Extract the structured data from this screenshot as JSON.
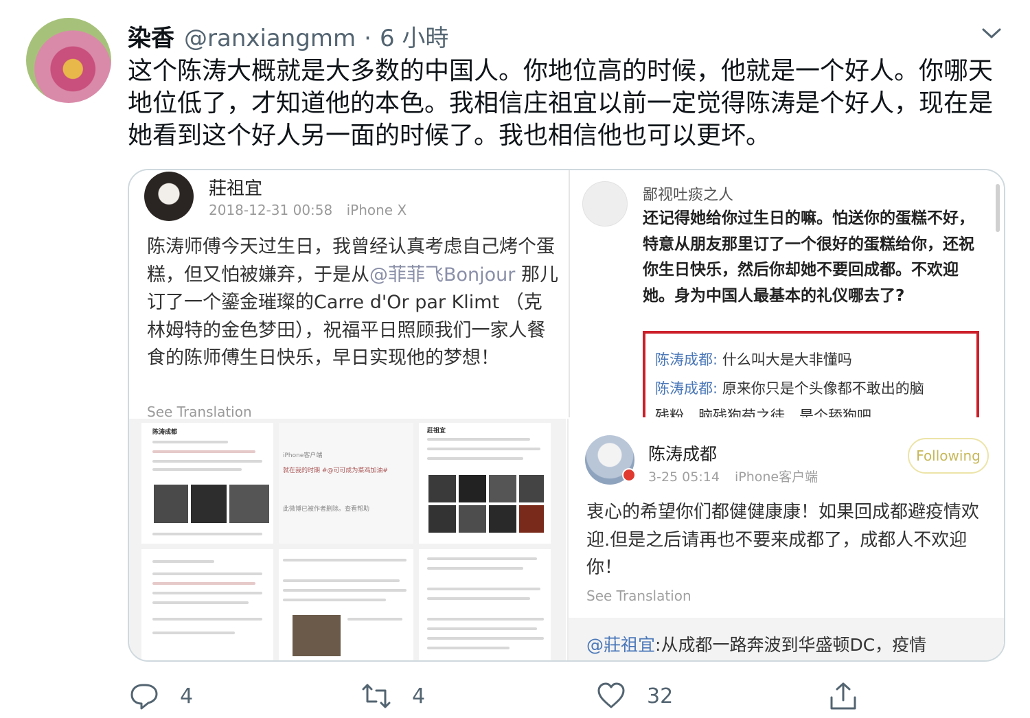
{
  "tweet": {
    "display_name": "染香",
    "handle": "@ranxiangmm",
    "separator": "·",
    "time": "6 小時",
    "text": "这个陈涛大概就是大多数的中国人。你地位高的时候，他就是一个好人。你哪天地位低了，才知道他的本色。我相信庄祖宜以前一定觉得陈涛是个好人，现在是她看到这个好人另一面的时候了。我也相信他也可以更坏。",
    "more_icon": "chevron-down-icon"
  },
  "media": {
    "post_a": {
      "name": "莊祖宜",
      "timestamp": "2018-12-31 00:58",
      "device": "iPhone X",
      "body_1": "陈涛师傅今天过生日，我曾经认真考虑自己烤个蛋糕，但又怕被嫌弃，于是从",
      "mention": "@菲菲飞Bonjour",
      "body_2": " 那儿订了一个鎏金璀璨的Carre d'Or par Klimt （克林姆特的金色梦田），祝福平日照顾我们一家人餐食的陈师傅生日快乐，早日实现他的梦想！",
      "see_translation": "See Translation"
    },
    "comment": {
      "name": "鄙视吐痰之人",
      "body": "还记得她给你过生日的嘛。怕送你的蛋糕不好，特意从朋友那里订了一个很好的蛋糕给你，还祝你生日快乐，然后你却她不要回成都。不欢迎她。身为中国人最基本的礼仪哪去了?",
      "replies": [
        {
          "who": "陈涛成都:",
          "text": " 什么叫大是大非懂吗"
        },
        {
          "who": "陈涛成都:",
          "text": " 原来你只是个头像都不敢出的脑"
        },
        {
          "who": "",
          "text": "残粉，脑残狗苟之徒，是个舔狗吧"
        }
      ]
    },
    "collage": {
      "left_top": "陈涛成都",
      "middle_top": "iPhone客户端",
      "middle_line": "就在我的时期 #@可可成为菜鸡加油#",
      "middle_notice": "此微博已被作者删除。查看帮助",
      "right_top": "莊祖宜"
    },
    "post_b": {
      "name": "陈涛成都",
      "timestamp": "3-25 05:14",
      "device": "iPhone客户端",
      "follow_label": "Following",
      "body": "衷心的希望你们都健健康康！如果回成都避疫情欢迎.但是之后请再也不要来成都了，成都人不欢迎你！",
      "see_translation": "See Translation",
      "quote_mention": "@莊祖宜",
      "quote_text": ":从成都一路奔波到华盛顿DC，疫情"
    }
  },
  "actions": {
    "reply_count": "4",
    "retweet_count": "4",
    "like_count": "32",
    "icons": [
      "reply-icon",
      "retweet-icon",
      "like-icon",
      "share-icon"
    ]
  }
}
